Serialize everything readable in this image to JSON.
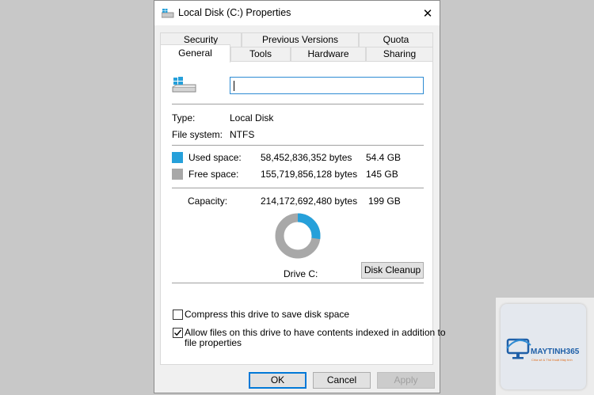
{
  "window": {
    "title": "Local Disk (C:) Properties",
    "close_glyph": "✕"
  },
  "tabs": {
    "row1": [
      {
        "label": "Security"
      },
      {
        "label": "Previous Versions"
      },
      {
        "label": "Quota"
      }
    ],
    "row2": [
      {
        "label": "General",
        "active": true
      },
      {
        "label": "Tools"
      },
      {
        "label": "Hardware"
      },
      {
        "label": "Sharing"
      }
    ]
  },
  "general": {
    "drive_icon": "drive-icon",
    "name_value": "",
    "type_label": "Type:",
    "type_value": "Local Disk",
    "fs_label": "File system:",
    "fs_value": "NTFS",
    "used": {
      "label": "Used space:",
      "bytes": "58,452,836,352 bytes",
      "size": "54.4 GB",
      "color": "#26a0da"
    },
    "free": {
      "label": "Free space:",
      "bytes": "155,719,856,128 bytes",
      "size": "145 GB",
      "color": "#a8a8a8"
    },
    "capacity": {
      "label": "Capacity:",
      "bytes": "214,172,692,480 bytes",
      "size": "199 GB"
    },
    "used_fraction": 0.273,
    "drive_label": "Drive C:",
    "disk_cleanup_label": "Disk Cleanup",
    "compress_label": "Compress this drive to save disk space",
    "compress_checked": false,
    "index_label_line1": "Allow files on this drive to have contents indexed in addition to",
    "index_label_line2": "file properties",
    "index_checked": true
  },
  "buttons": {
    "ok": "OK",
    "cancel": "Cancel",
    "apply": "Apply"
  },
  "watermark": {
    "brand": "MAYTINH365",
    "tagline": "Chia sẻ & Thủ thuật Máy tính"
  }
}
